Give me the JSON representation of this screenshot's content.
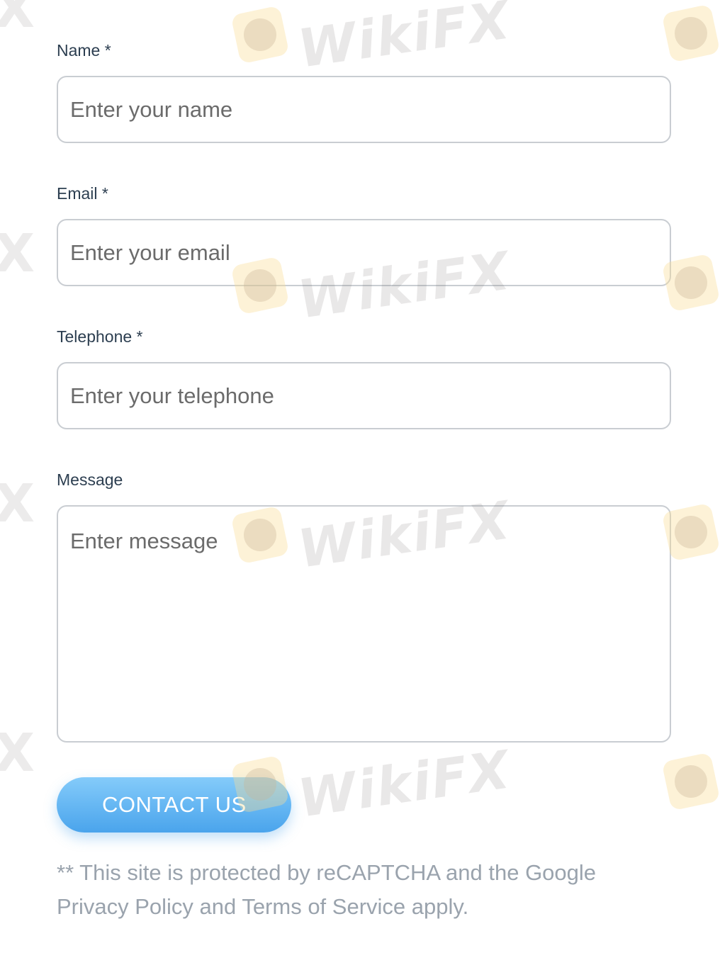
{
  "form": {
    "name": {
      "label": "Name *",
      "placeholder": "Enter your name"
    },
    "email": {
      "label": "Email *",
      "placeholder": "Enter your email"
    },
    "telephone": {
      "label": "Telephone *",
      "placeholder": "Enter your telephone"
    },
    "message": {
      "label": "Message",
      "placeholder": "Enter message"
    },
    "submit_label": "CONTACT US",
    "recaptcha_note": "** This site is protected by reCAPTCHA and the Google Privacy Policy and Terms of Service apply."
  },
  "watermark": {
    "text": "WikiFX",
    "fragment": "X"
  },
  "colors": {
    "label": "#2c3e50",
    "field_border": "#c9cdd2",
    "button_top": "#84cbfa",
    "button_bottom": "#4aa4ec",
    "note": "#9aa3ad"
  }
}
